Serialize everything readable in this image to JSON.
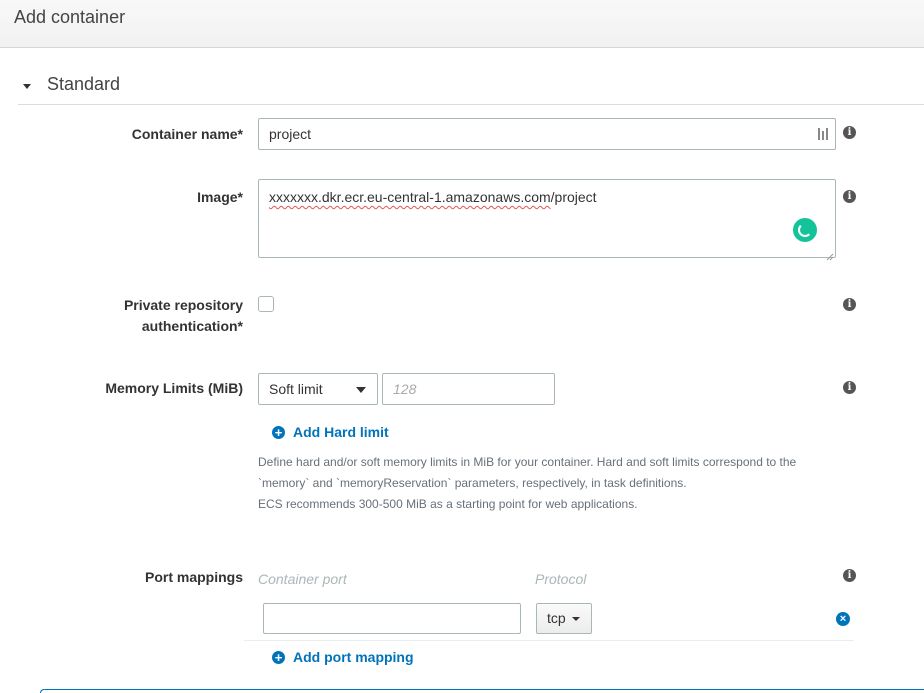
{
  "header": {
    "title": "Add container"
  },
  "section": {
    "title": "Standard",
    "toggle_icon": "caret-down-icon"
  },
  "fields": {
    "container_name": {
      "label": "Container name*",
      "value": "project"
    },
    "image": {
      "label": "Image*",
      "value_underlined": "xxxxxxx.dkr.ecr.eu-central-1.amazonaws.com",
      "value_rest": "/project"
    },
    "private_repo_auth": {
      "label_line1": "Private repository",
      "label_line2": "authentication*",
      "checked": false
    },
    "memory_limits": {
      "label": "Memory Limits (MiB)",
      "select_value": "Soft limit",
      "placeholder": "128",
      "add_hard_limit": "Add Hard limit",
      "help_line1": "Define hard and/or soft memory limits in MiB for your container. Hard and soft limits correspond to the",
      "help_line2": "`memory` and `memoryReservation` parameters, respectively, in task definitions.",
      "help_line3": "ECS recommends 300-500 MiB as a starting point for web applications."
    },
    "port_mappings": {
      "label": "Port mappings",
      "col_container_port": "Container port",
      "col_protocol": "Protocol",
      "container_port_value": "",
      "protocol_value": "tcp",
      "add_port_mapping": "Add port mapping"
    }
  },
  "icons": {
    "info": "info-icon",
    "add": "plus-circle-icon",
    "remove": "remove-circle-icon",
    "grammar": "grammar-check-icon",
    "keyboard": "input-keyboard-icon"
  },
  "colors": {
    "link": "#0073bb",
    "grammar": "#15c39a",
    "info_icon": "#555555"
  }
}
